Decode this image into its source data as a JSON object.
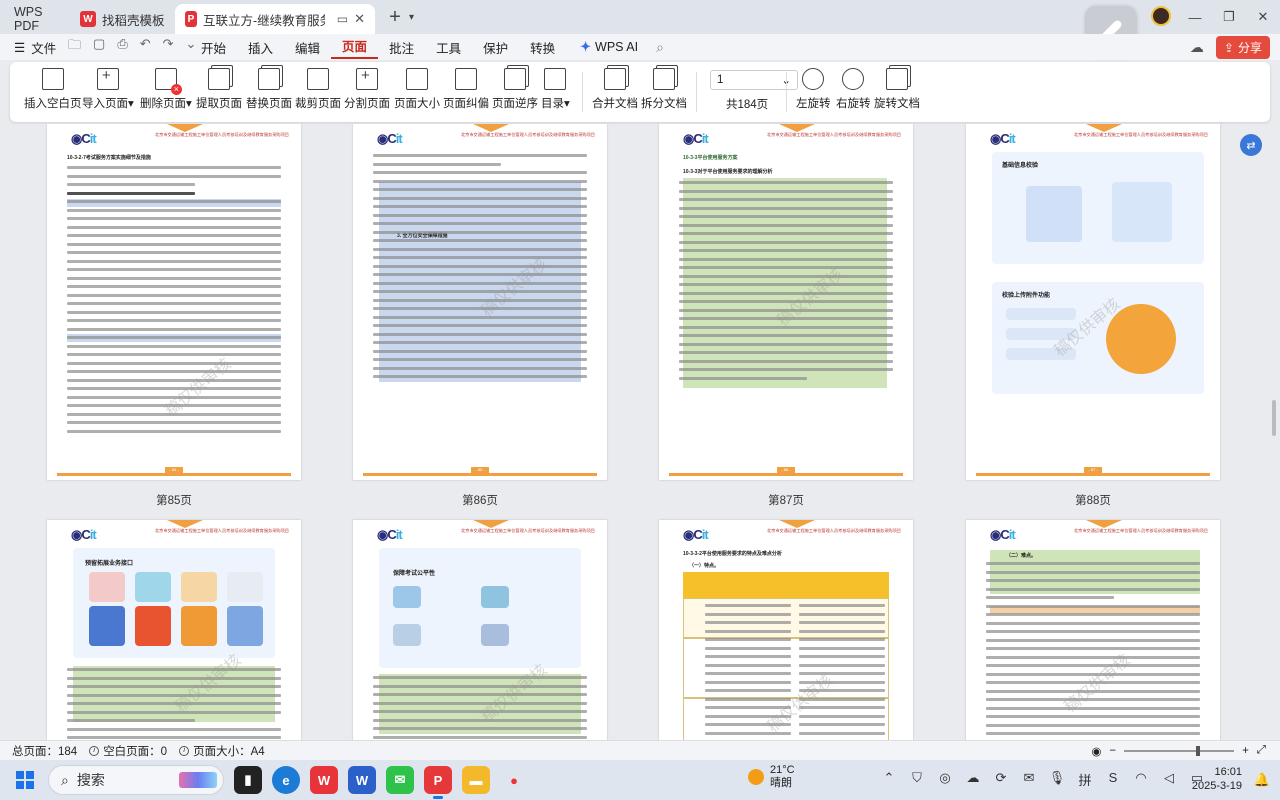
{
  "tabs": {
    "home": "WPS PDF",
    "tab1": "找稻壳模板",
    "tab2": "互联立方-继续教育服务及课E"
  },
  "menu": {
    "file": "文件",
    "items": [
      "开始",
      "插入",
      "编辑",
      "页面",
      "批注",
      "工具",
      "保护",
      "转换"
    ],
    "active": "页面",
    "wps_ai": "WPS AI",
    "share": "分享"
  },
  "ribbon": {
    "buttons": [
      "插入空白页",
      "导入页面",
      "删除页面",
      "提取页面",
      "替换页面",
      "裁剪页面",
      "分割页面",
      "页面大小",
      "页面纠偏",
      "页面逆序",
      "目录",
      "合并文档",
      "拆分文档"
    ],
    "dropdown_marks": [
      "▾"
    ],
    "page_input": "1",
    "page_total": "共184页",
    "rotate": [
      "左旋转",
      "右旋转",
      "旋转文档"
    ]
  },
  "pages": {
    "labels": [
      "第85页",
      "第86页",
      "第87页",
      "第88页"
    ],
    "p85_title": "10-3-2-7考试服务方案实施细节及措施",
    "p86_title": "3. 全方位安全保障措施",
    "p87_title": "10-3-3对于平台使用服务要求的理解分析",
    "p87_sub": "10-3-3平台使用服务方案",
    "p88_title1": "基础信息校验",
    "p88_title2": "校验上传附件功能",
    "p89_title": "预留拓展业务接口",
    "p90_title": "保障考试公平性",
    "p91_title": "10-3-3-2平台使用服务要求的特点及难点分析",
    "p91_sub": "（一）特点。",
    "p92_sub": "（二）难点。",
    "watermark": "稿仅供审核",
    "footer_nums": [
      "- 84 -",
      "- 85 -",
      "- 86 -",
      "- 87 -"
    ]
  },
  "status": {
    "total_pages": "总页面：184",
    "blank_pages": "空白页面：0",
    "page_size": "页面大小：A4"
  },
  "taskbar": {
    "search": "搜索",
    "weather_temp": "21°C",
    "weather_text": "晴朗",
    "time": "16:01",
    "date": "2025-3-19"
  }
}
